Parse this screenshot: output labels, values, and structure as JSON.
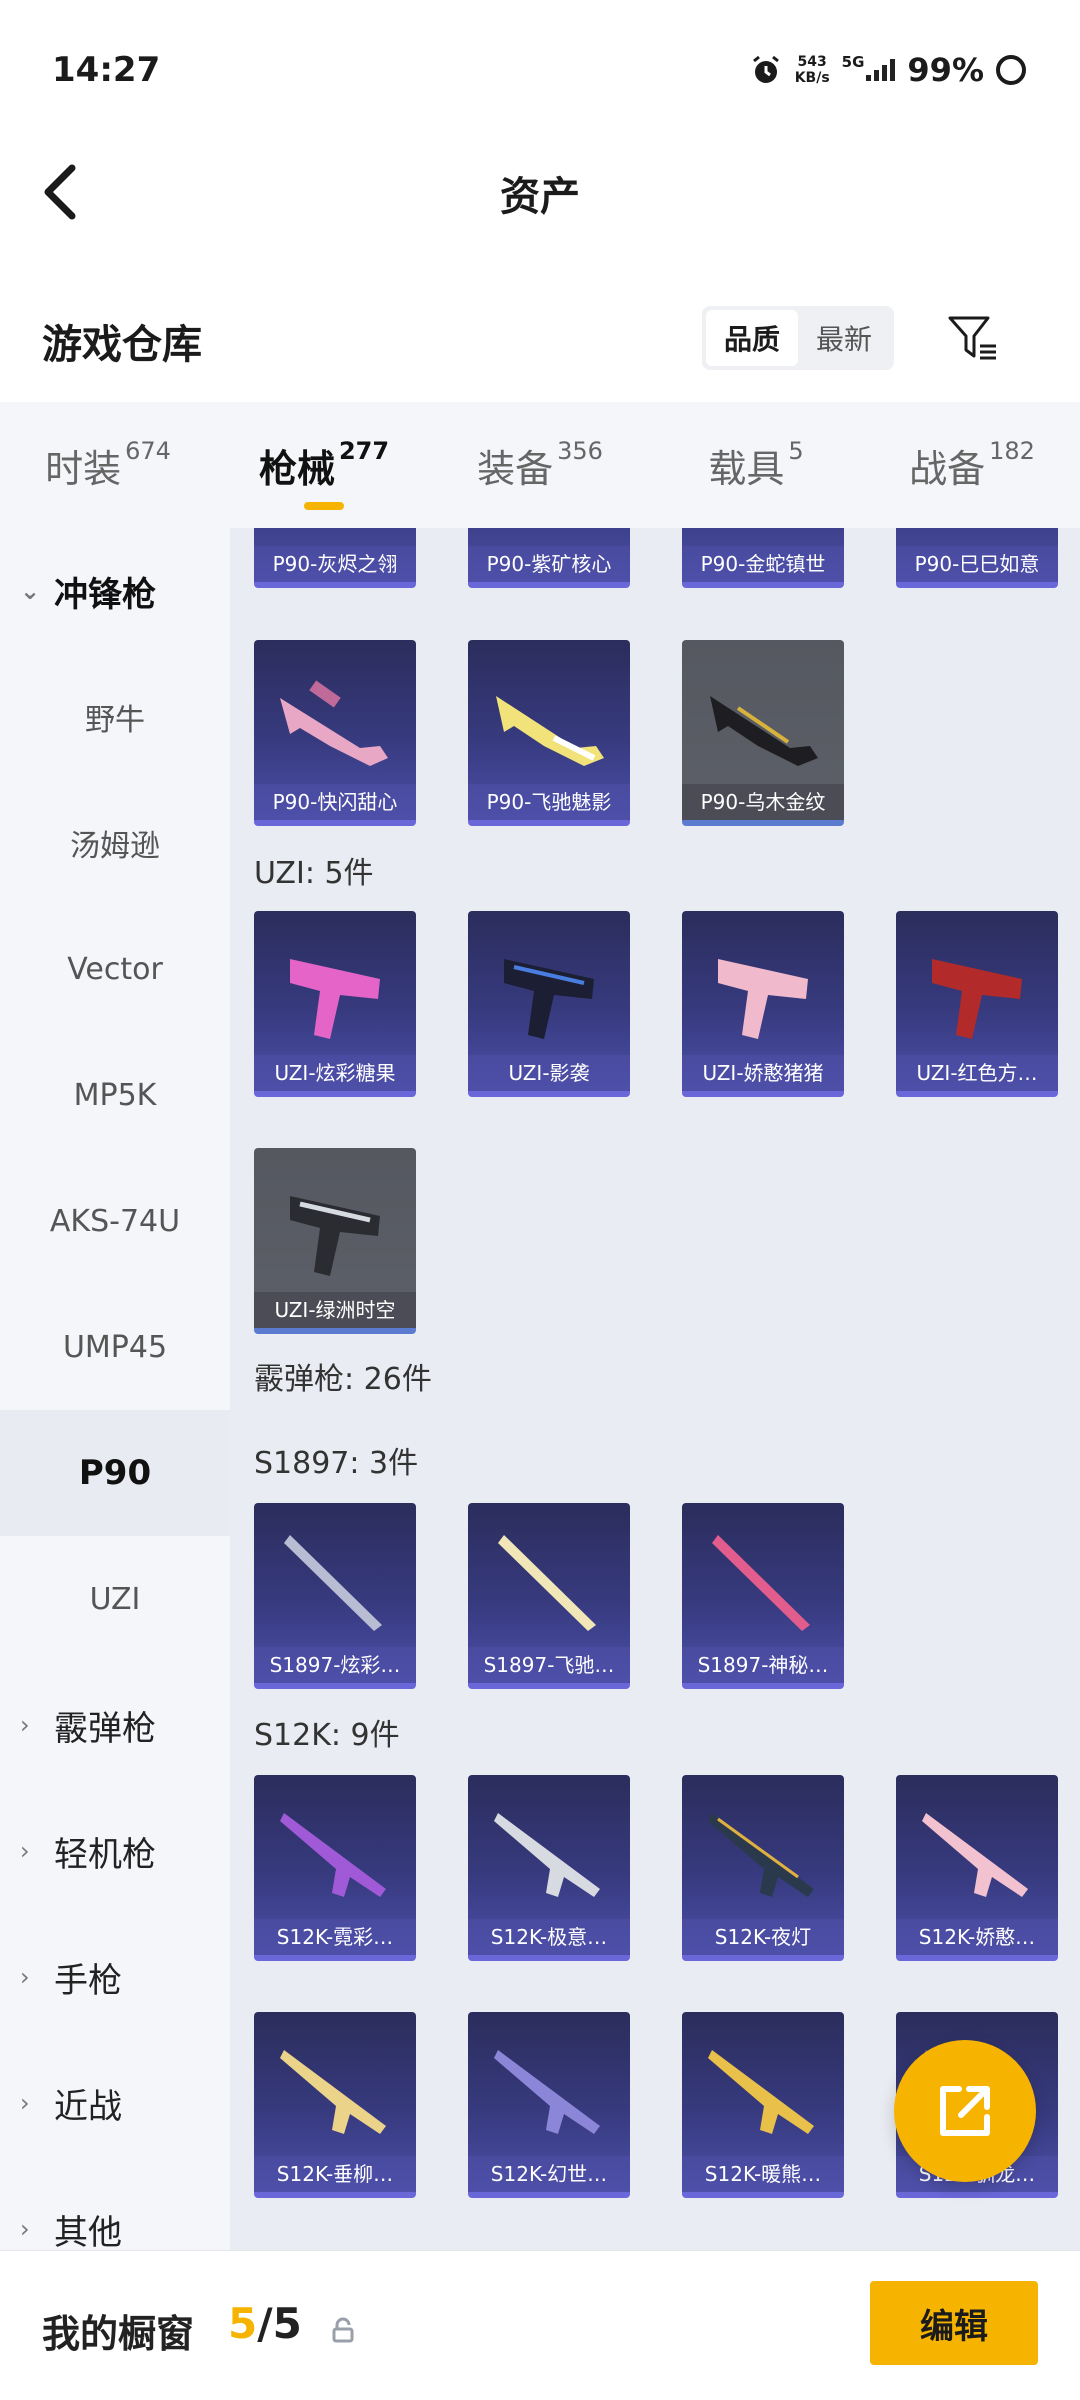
{
  "status_bar": {
    "time": "14:27",
    "net_speed": "543",
    "net_unit": "KB/s",
    "network": "5G",
    "battery": "99%"
  },
  "header": {
    "title": "资产"
  },
  "storage": {
    "title": "游戏仓库",
    "sort_options": [
      "品质",
      "最新"
    ],
    "sort_selected": "品质"
  },
  "tabs": [
    {
      "label": "时装",
      "count": "674",
      "active": false
    },
    {
      "label": "枪械",
      "count": "277",
      "active": true
    },
    {
      "label": "装备",
      "count": "356",
      "active": false
    },
    {
      "label": "载具",
      "count": "5",
      "active": false
    },
    {
      "label": "战备",
      "count": "182",
      "active": false
    }
  ],
  "sidebar": {
    "groups": [
      {
        "label": "冲锋枪",
        "expanded": true,
        "items": [
          "野牛",
          "汤姆逊",
          "Vector",
          "MP5K",
          "AKS-74U",
          "UMP45",
          "P90",
          "UZI"
        ],
        "active_item": "P90"
      },
      {
        "label": "霰弹枪"
      },
      {
        "label": "轻机枪"
      },
      {
        "label": "手枪"
      },
      {
        "label": "近战"
      },
      {
        "label": "其他"
      }
    ]
  },
  "content": {
    "top_partial": [
      "P90-灰烬之翎",
      "P90-紫矿核心",
      "P90-金蛇镇世",
      "P90-巳巳如意"
    ],
    "p90_rest": [
      "P90-快闪甜心",
      "P90-飞驰魅影",
      "P90-乌木金纹"
    ],
    "uzi": {
      "header": "UZI: 5件",
      "items": [
        "UZI-炫彩糖果",
        "UZI-影袭",
        "UZI-娇憨猪猪",
        "UZI-红色方…",
        "UZI-绿洲时空"
      ]
    },
    "shotgun_header": "霰弹枪: 26件",
    "s1897": {
      "header": "S1897: 3件",
      "items": [
        "S1897-炫彩…",
        "S1897-飞驰…",
        "S1897-神秘…"
      ]
    },
    "s12k": {
      "header": "S12K: 9件",
      "items": [
        "S12K-霓彩…",
        "S12K-极意…",
        "S12K-夜灯",
        "S12K-娇憨…",
        "S12K-垂柳…",
        "S12K-幻世…",
        "S12K-暖熊…",
        "S12K-驯龙…"
      ]
    }
  },
  "bottom": {
    "label": "我的橱窗",
    "current": "5",
    "separator": "/",
    "total": "5",
    "edit_label": "编辑"
  },
  "colors": {
    "accent": "#f6b400",
    "card_purple": "#373a7e",
    "card_gray": "#5a5d65"
  }
}
